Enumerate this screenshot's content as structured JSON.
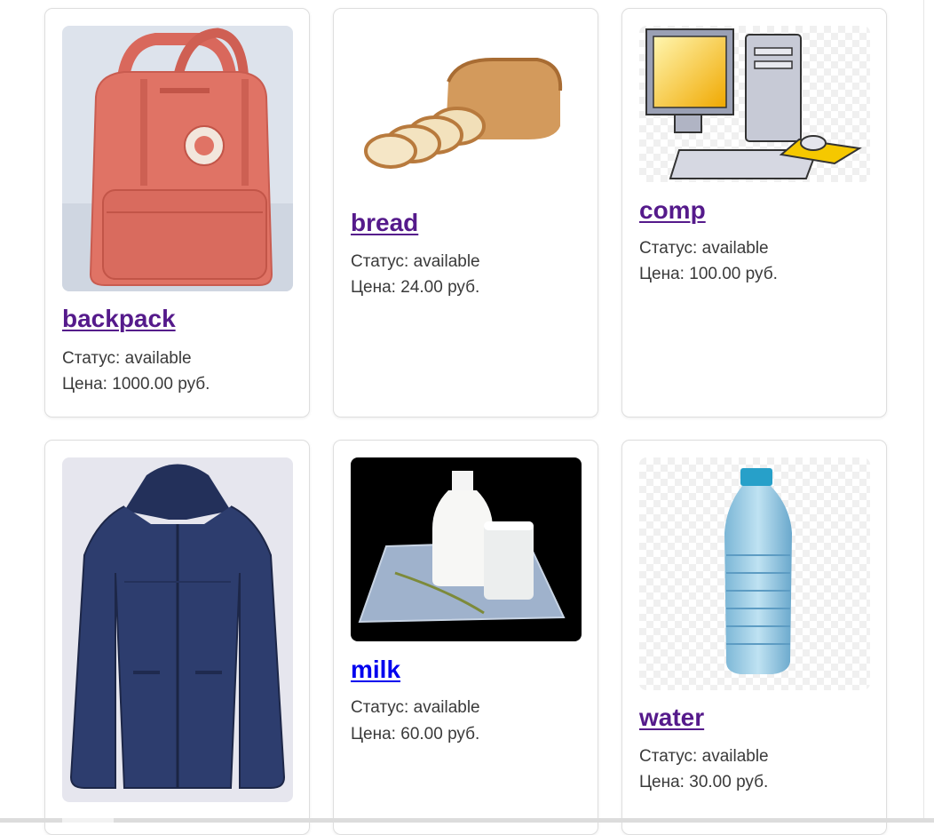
{
  "products": [
    {
      "name": "backpack",
      "status_label": "Статус:",
      "status": "available",
      "price_label": "Цена:",
      "price": "1000.00",
      "currency": "руб.",
      "image_icon": "backpack-image"
    },
    {
      "name": "bread",
      "status_label": "Статус:",
      "status": "available",
      "price_label": "Цена:",
      "price": "24.00",
      "currency": "руб.",
      "image_icon": "bread-image"
    },
    {
      "name": "comp",
      "status_label": "Статус:",
      "status": "available",
      "price_label": "Цена:",
      "price": "100.00",
      "currency": "руб.",
      "image_icon": "computer-image"
    },
    {
      "name": "",
      "status_label": "",
      "status": "",
      "price_label": "",
      "price": "",
      "currency": "",
      "image_icon": "jacket-image"
    },
    {
      "name": "milk",
      "status_label": "Статус:",
      "status": "available",
      "price_label": "Цена:",
      "price": "60.00",
      "currency": "руб.",
      "image_icon": "milk-image"
    },
    {
      "name": "water",
      "status_label": "Статус:",
      "status": "available",
      "price_label": "Цена:",
      "price": "30.00",
      "currency": "руб.",
      "image_icon": "water-bottle-image"
    }
  ],
  "colors": {
    "visited_link": "#551a8b",
    "unvisited_link": "#0000ee",
    "card_border": "#dedede",
    "body_text": "#3a3a3a"
  }
}
